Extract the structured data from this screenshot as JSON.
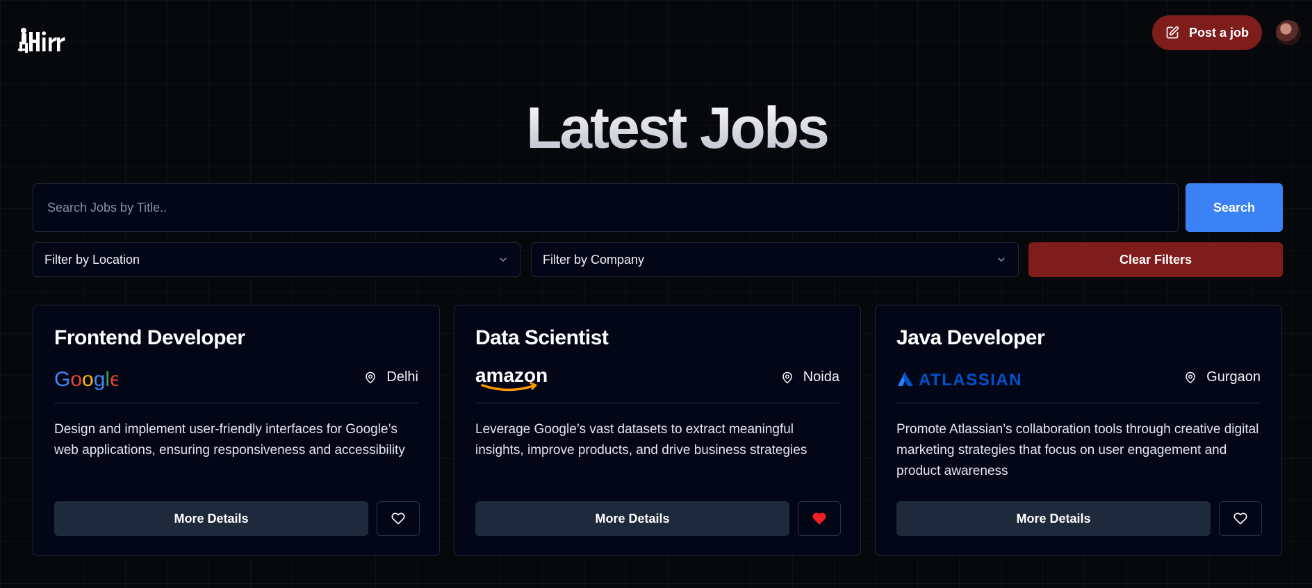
{
  "header": {
    "post_job_label": "Post a job"
  },
  "page": {
    "title": "Latest Jobs"
  },
  "search": {
    "placeholder": "Search Jobs by Title..",
    "button_label": "Search"
  },
  "filters": {
    "location_label": "Filter by Location",
    "company_label": "Filter by Company",
    "clear_label": "Clear Filters"
  },
  "jobs": [
    {
      "title": "Frontend Developer",
      "company_logo": "google-logo",
      "location": "Delhi",
      "description": "Design and implement user-friendly interfaces for Google’s web applications, ensuring responsiveness and accessibility",
      "details_label": "More Details",
      "saved": false
    },
    {
      "title": "Data Scientist",
      "company_logo": "amazon-logo",
      "location": "Noida",
      "description": "Leverage Google’s vast datasets to extract meaningful insights, improve products, and drive business strategies",
      "details_label": "More Details",
      "saved": true
    },
    {
      "title": "Java Developer",
      "company_logo": "atlassian-logo",
      "location": "Gurgaon",
      "description": "Promote Atlassian’s collaboration tools through creative digital marketing strategies that focus on user engagement and product awareness",
      "details_label": "More Details",
      "saved": false
    }
  ],
  "colors": {
    "background": "#07080c",
    "primary_blue": "#3b82f6",
    "accent_red": "#7f1d1d",
    "saved_heart": "#ef1f24",
    "card_bg": "#030617",
    "secondary_button": "#1e293b"
  }
}
